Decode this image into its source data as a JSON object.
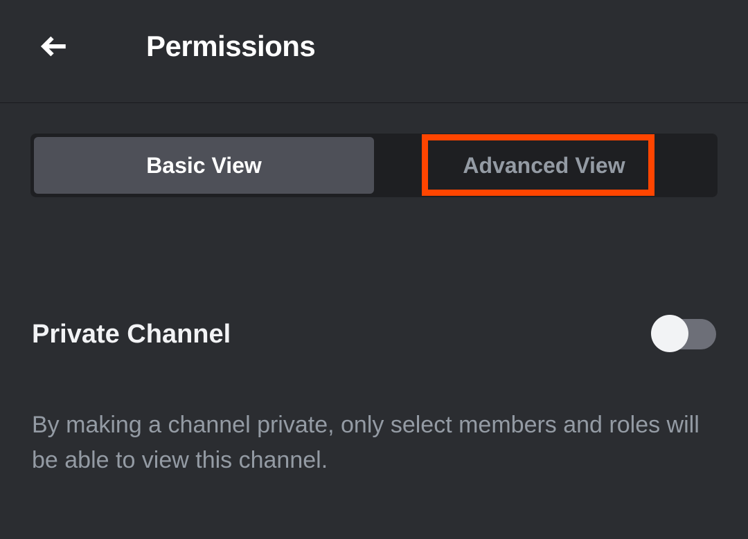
{
  "header": {
    "title": "Permissions"
  },
  "tabs": {
    "basic": "Basic View",
    "advanced": "Advanced View"
  },
  "settings": {
    "privateChannel": {
      "label": "Private Channel",
      "description": "By making a channel private, only select members and roles will be able to view this channel.",
      "enabled": false
    }
  }
}
